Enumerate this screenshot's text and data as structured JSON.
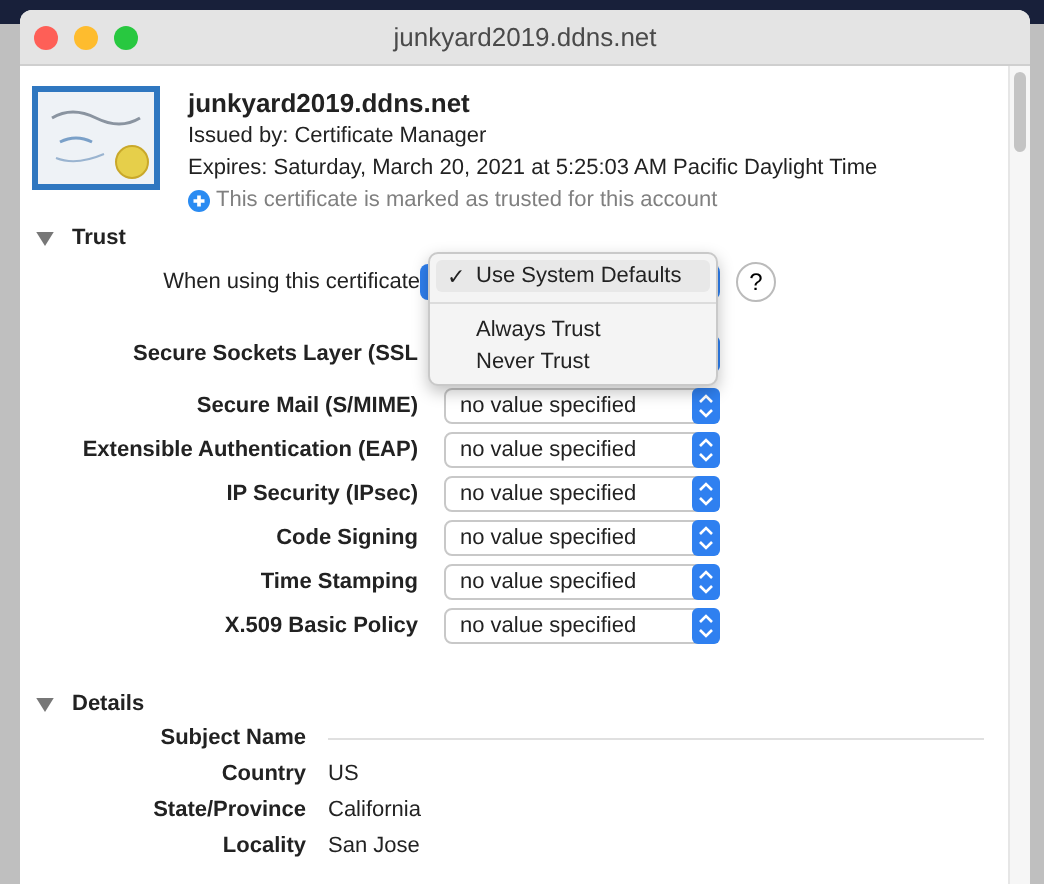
{
  "window": {
    "title": "junkyard2019.ddns.net"
  },
  "certificate": {
    "name": "junkyard2019.ddns.net",
    "issued_by": "Issued by: Certificate Manager",
    "expires": "Expires: Saturday, March 20, 2021 at 5:25:03 AM Pacific Daylight Time",
    "trust_note": "This certificate is marked as trusted for this account"
  },
  "trust": {
    "heading": "Trust",
    "expanded": true,
    "when_using_label": "When using this certificate",
    "help": "?",
    "check": "✓",
    "menu": [
      {
        "label": "Use System Defaults",
        "selected": true
      },
      {
        "label": "Always Trust",
        "selected": false
      },
      {
        "label": "Never Trust",
        "selected": false
      }
    ],
    "policies": [
      {
        "label": "Secure Sockets Layer (SSL"
      },
      {
        "label": "Secure Mail (S/MIME)",
        "value": "no value specified"
      },
      {
        "label": "Extensible Authentication (EAP)",
        "value": "no value specified"
      },
      {
        "label": "IP Security (IPsec)",
        "value": "no value specified"
      },
      {
        "label": "Code Signing",
        "value": "no value specified"
      },
      {
        "label": "Time Stamping",
        "value": "no value specified"
      },
      {
        "label": "X.509 Basic Policy",
        "value": "no value specified"
      }
    ]
  },
  "details": {
    "heading": "Details",
    "expanded": true,
    "rows": [
      {
        "kind": "section",
        "label": "Subject Name"
      },
      {
        "kind": "field",
        "label": "Country",
        "value": "US"
      },
      {
        "kind": "field",
        "label": "State/Province",
        "value": "California"
      },
      {
        "kind": "field",
        "label": "Locality",
        "value": "San Jose"
      }
    ]
  }
}
